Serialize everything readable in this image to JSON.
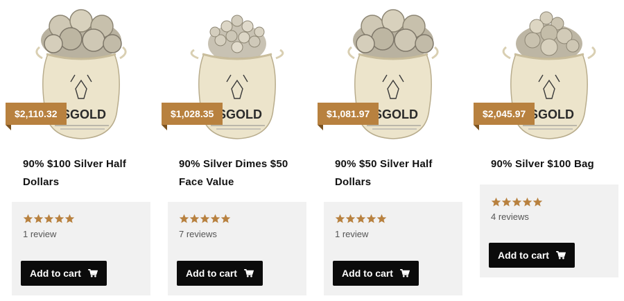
{
  "products": [
    {
      "price": "$2,110.32",
      "title": "90% $100 Silver Half Dollars",
      "reviews": "1 review",
      "rating": 5,
      "add_to_cart_label": "Add to cart",
      "image": "coin-bag-half-dollars"
    },
    {
      "price": "$1,028.35",
      "title": "90% Silver Dimes $50 Face Value",
      "reviews": "7 reviews",
      "rating": 5,
      "add_to_cart_label": "Add to cart",
      "image": "coin-bag-dimes"
    },
    {
      "price": "$1,081.97",
      "title": "90% $50 Silver Half Dollars",
      "reviews": "1 review",
      "rating": 5,
      "add_to_cart_label": "Add to cart",
      "image": "coin-bag-half-dollars"
    },
    {
      "price": "$2,045.97",
      "title": "90% Silver $100 Bag",
      "reviews": "4 reviews",
      "rating": 5,
      "add_to_cart_label": "Add to cart",
      "image": "coin-bag-mixed"
    }
  ],
  "bag_brand_text": "SGOLD",
  "colors": {
    "accent": "#b8813f",
    "accent_dark": "#7b5220",
    "button_bg": "#0b0b0b",
    "card_bottom_bg": "#f1f1f1",
    "star": "#b8813f"
  }
}
